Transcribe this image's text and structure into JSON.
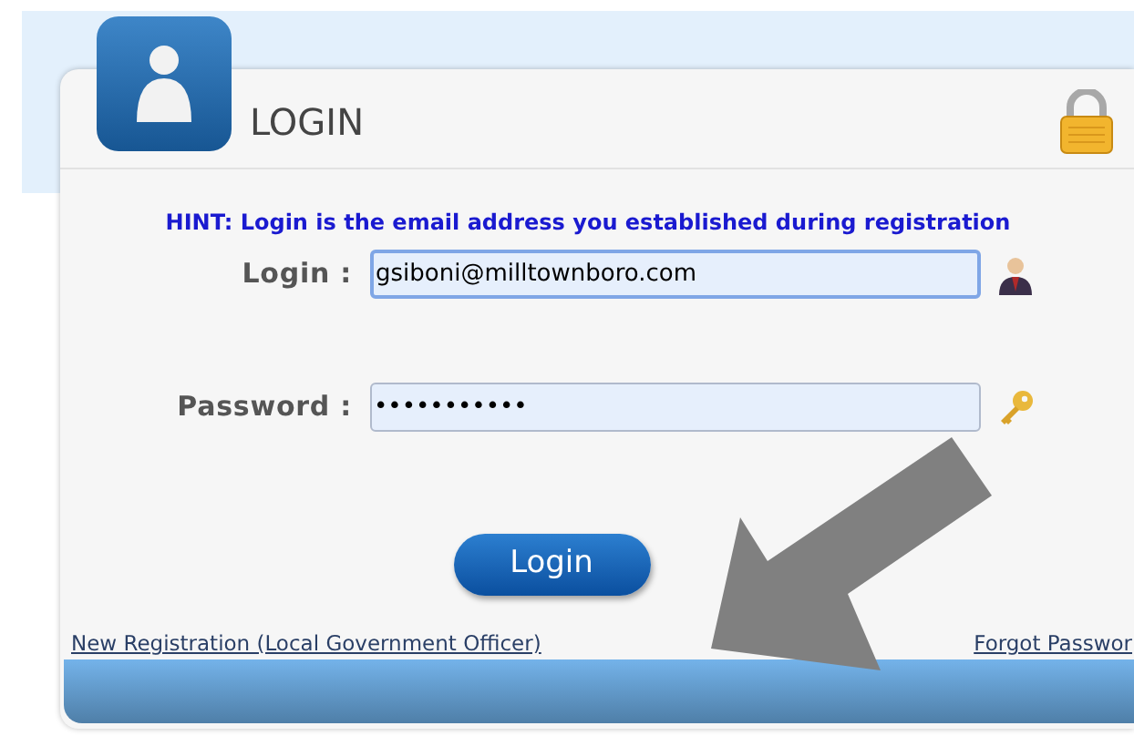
{
  "header": {
    "title": "LOGIN"
  },
  "hint": "HINT: Login is the email address you established during registration",
  "fields": [
    {
      "kind": "login",
      "label": "Login :",
      "value": "gsiboni@milltownboro.com",
      "focused": true
    },
    {
      "kind": "password",
      "label": "Password :",
      "value": "•••••••••••",
      "focused": false
    }
  ],
  "submit": "Login",
  "links": [
    "New Registration (Local Government Officer)",
    "Forgot Passwor"
  ]
}
